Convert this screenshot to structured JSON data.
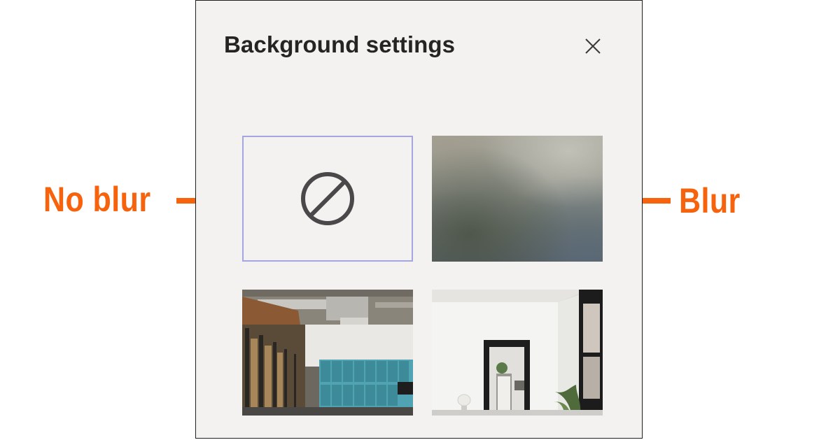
{
  "panel": {
    "title": "Background settings",
    "close_icon": "close-icon"
  },
  "backgrounds": [
    {
      "id": "none",
      "label": "No background",
      "icon": "no-background-icon",
      "selected": true
    },
    {
      "id": "blur",
      "label": "Blur",
      "selected": false
    },
    {
      "id": "office",
      "label": "Office with lockers",
      "selected": false
    },
    {
      "id": "room",
      "label": "White room with mirror",
      "selected": false
    }
  ],
  "annotations": {
    "left_label": "No blur",
    "right_label": "Blur",
    "color": "#f7630c"
  },
  "colors": {
    "panel_bg": "#f3f2f1",
    "selected_border": "#a4a6e0",
    "title_text": "#252423",
    "annotation": "#f7630c"
  }
}
